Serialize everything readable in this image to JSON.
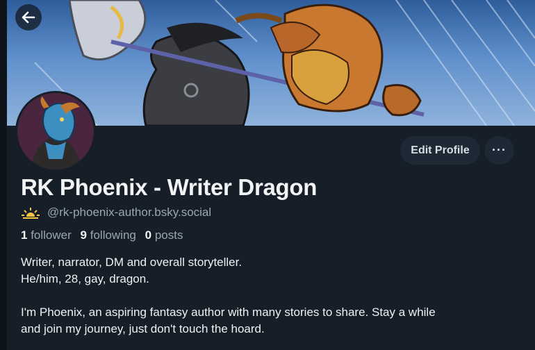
{
  "profile": {
    "display_name": "RK Phoenix - Writer Dragon",
    "handle": "@rk-phoenix-author.bsky.social",
    "stats": {
      "followers_count": "1",
      "followers_label": "follower",
      "following_count": "9",
      "following_label": "following",
      "posts_count": "0",
      "posts_label": "posts"
    },
    "bio": [
      "Writer, narrator, DM and overall storyteller.",
      "He/him, 28, gay, dragon.",
      "",
      "I'm Phoenix, an aspiring fantasy author with many stories to share. Stay a while",
      "and join my journey, just don't touch the hoard."
    ]
  },
  "actions": {
    "edit_profile_label": "Edit Profile",
    "more_label": "···"
  },
  "icons": {
    "back": "arrow-left-icon",
    "handle_badge": "sunrise-icon"
  },
  "colors": {
    "background": "#161e27",
    "secondary_text": "#9aa6b4",
    "button_bg": "#1e2936",
    "handle_icon": "#f5c542"
  }
}
